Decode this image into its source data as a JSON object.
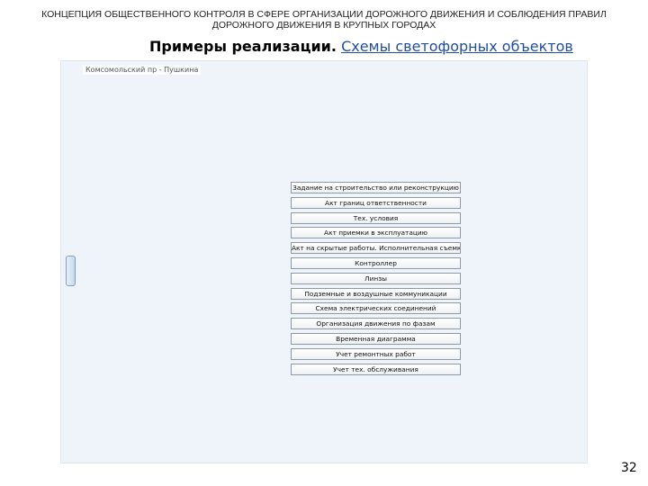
{
  "header": {
    "line1": "КОНЦЕПЦИЯ ОБЩЕСТВЕННОГО КОНТРОЛЯ В СФЕРЕ ОРГАНИЗАЦИИ ДОРОЖНОГО ДВИЖЕНИЯ И СОБЛЮДЕНИЯ ПРАВИЛ",
    "line2": "ДОРОЖНОГО ДВИЖЕНИЯ В КРУПНЫХ ГОРОДАХ"
  },
  "subtitle": {
    "bold": "Примеры реализации.",
    "link": "Схемы светофорных объектов"
  },
  "app": {
    "window_title": "Комсомольский пр - Пушкина",
    "buttons": [
      "Задание на строительство или реконструкцию",
      "Акт границ ответственности",
      "Тех. условия",
      "Акт приемки в эксплуатацию",
      "Акт на скрытые работы. Исполнительная съемка",
      "Контроллер",
      "Линзы",
      "Подземные и воздушные коммуникации",
      "Схема электрических соединений",
      "Организация движения по фазам",
      "Временная диаграмма",
      "Учет ремонтных работ",
      "Учет тех. обслуживания"
    ]
  },
  "page_number": "32"
}
